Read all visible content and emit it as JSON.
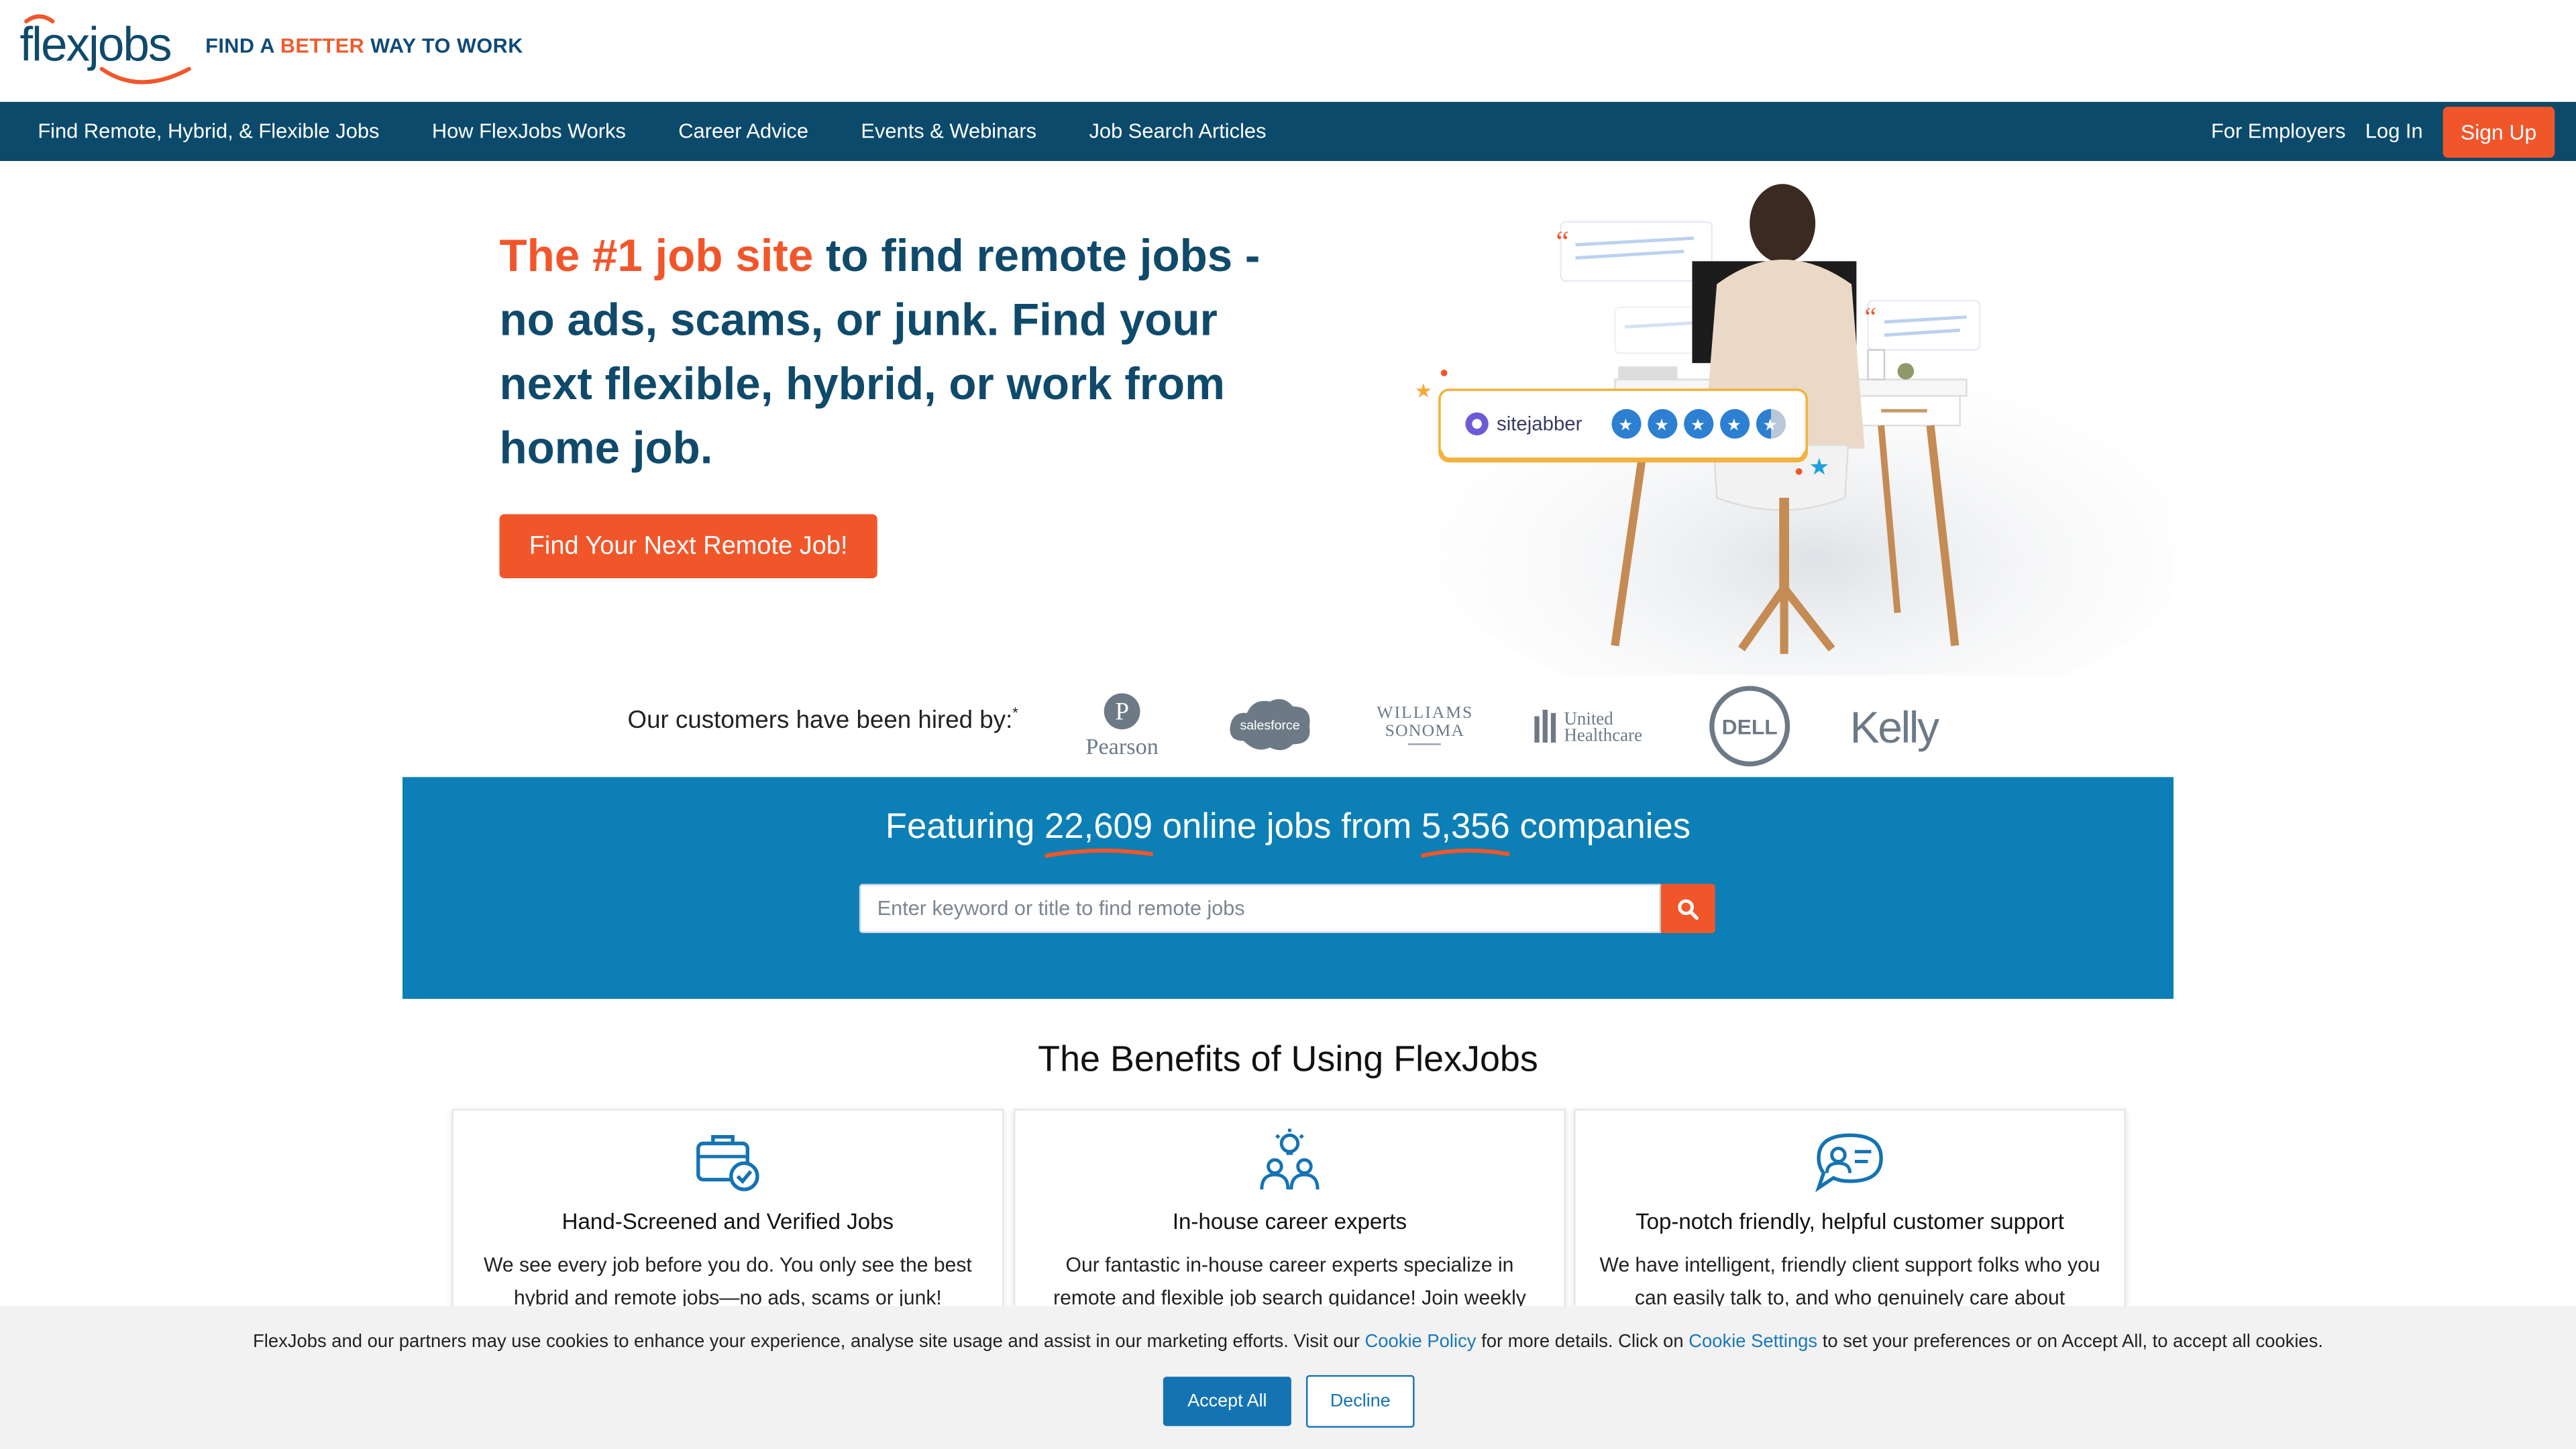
{
  "brand": {
    "logo_text": "flexjobs",
    "tagline_pre": "FIND A ",
    "tagline_highlight": "BETTER",
    "tagline_post": " WAY TO WORK",
    "colors": {
      "navy": "#0c4a6b",
      "orange": "#f1562b",
      "blue_band": "#0b7fb6",
      "link": "#1a78b8"
    }
  },
  "nav": {
    "items": [
      {
        "label": "Find Remote, Hybrid, & Flexible Jobs"
      },
      {
        "label": "How FlexJobs Works"
      },
      {
        "label": "Career Advice"
      },
      {
        "label": "Events & Webinars"
      },
      {
        "label": "Job Search Articles"
      }
    ],
    "for_employers": "For Employers",
    "login": "Log In",
    "signup": "Sign Up"
  },
  "hero": {
    "title_accent": "The #1 job site",
    "title_rest": " to find remote jobs - no ads, scams, or junk. Find your next flexible, hybrid, or work from home job.",
    "cta": "Find Your Next Remote Job!",
    "review_badge": {
      "site": "sitejabber",
      "stars_rating": 4.5,
      "stars_max": 5
    }
  },
  "hired_by": {
    "label": "Our customers have been hired by:",
    "footnote_mark": "*",
    "logos": [
      {
        "name": "Pearson",
        "icon": "pearson-logo"
      },
      {
        "name": "salesforce",
        "icon": "salesforce-logo"
      },
      {
        "name": "WILLIAMS SONOMA",
        "icon": "williams-sonoma-logo"
      },
      {
        "name": "United Healthcare",
        "icon": "united-healthcare-logo"
      },
      {
        "name": "DELL",
        "icon": "dell-logo"
      },
      {
        "name": "Kelly",
        "icon": "kelly-logo"
      }
    ]
  },
  "featuring": {
    "pre": "Featuring ",
    "jobs_count": "22,609",
    "mid": " online jobs from ",
    "companies_count": "5,356",
    "post": " companies"
  },
  "search": {
    "placeholder": "Enter keyword or title to find remote jobs",
    "value": "",
    "button_icon": "search-icon"
  },
  "benefits": {
    "title": "The Benefits of Using FlexJobs",
    "cards": [
      {
        "icon": "briefcase-check-icon",
        "title": "Hand-Screened and Verified Jobs",
        "text": "We see every job before you do. You only see the best hybrid and remote jobs—no ads, scams or junk!"
      },
      {
        "icon": "career-experts-icon",
        "title": "In-house career experts",
        "text": "Our fantastic in-house career experts specialize in remote and flexible job search guidance! Join weekly"
      },
      {
        "icon": "support-chat-icon",
        "title": "Top-notch friendly, helpful customer support",
        "text": "We have intelligent, friendly client support folks who you can easily talk to, and who genuinely care about"
      }
    ]
  },
  "cookie": {
    "text_1": "FlexJobs and our partners may use cookies to enhance your experience, analyse site usage and assist in our marketing efforts. Visit our ",
    "link_1": "Cookie Policy",
    "text_2": " for more details. Click on ",
    "link_2": "Cookie Settings",
    "text_3": " to set your preferences or on Accept All, to accept all cookies.",
    "accept": "Accept All",
    "decline": "Decline"
  }
}
